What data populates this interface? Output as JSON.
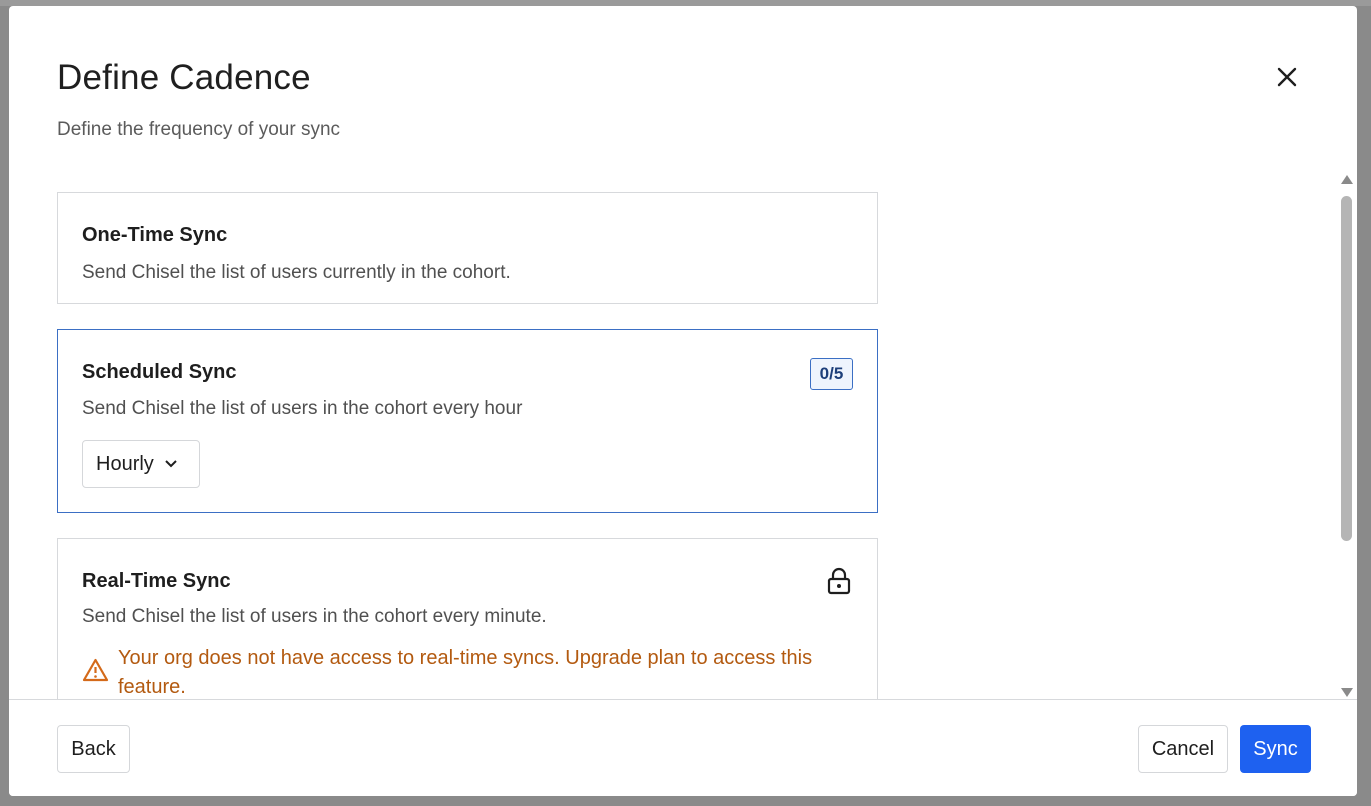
{
  "modal": {
    "title": "Define Cadence",
    "subtitle": "Define the frequency of your sync"
  },
  "options": [
    {
      "title": "One-Time Sync",
      "description": "Send Chisel the list of users currently in the cohort."
    },
    {
      "title": "Scheduled Sync",
      "description": "Send Chisel the list of users in the cohort every hour",
      "badge": "0/5",
      "frequency": "Hourly",
      "selected": true
    },
    {
      "title": "Real-Time Sync",
      "description": "Send Chisel the list of users in the cohort every minute.",
      "warning": "Your org does not have access to real-time syncs. Upgrade plan to access this feature.",
      "locked": true
    }
  ],
  "footer": {
    "back_label": "Back",
    "cancel_label": "Cancel",
    "sync_label": "Sync"
  },
  "colors": {
    "accent": "#1e61f0",
    "selected_border": "#3b6fc4",
    "warning": "#b35a10"
  },
  "icons": [
    "close-icon",
    "chevron-down-icon",
    "lock-icon",
    "warning-icon"
  ]
}
